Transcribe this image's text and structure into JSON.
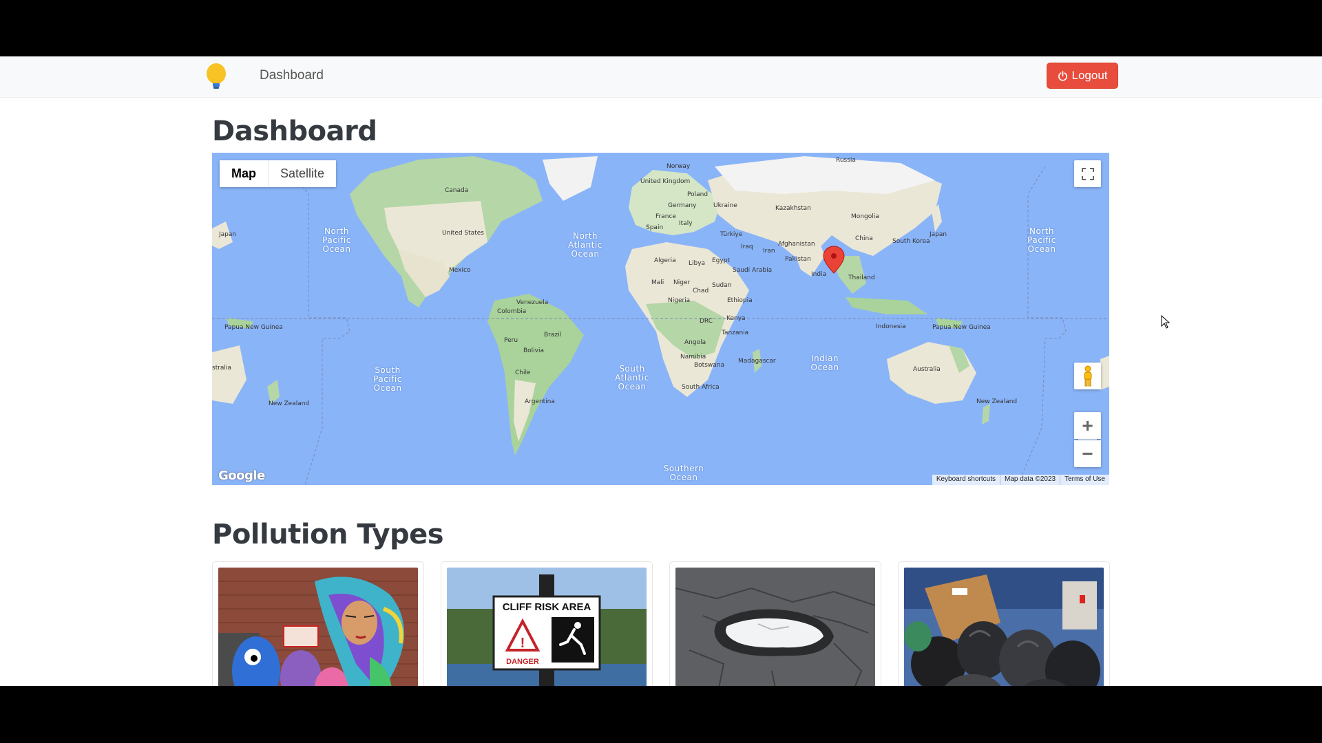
{
  "navbar": {
    "brand_icon": "lightbulb-icon",
    "nav_link": "Dashboard",
    "logout_label": "Logout",
    "logout_icon": "power-icon",
    "logout_color": "#e74c3c"
  },
  "page_title": "Dashboard",
  "map": {
    "map_type_options": [
      "Map",
      "Satellite"
    ],
    "selected_map_type": "Map",
    "oceans": [
      "North Pacific Ocean",
      "North Atlantic Ocean",
      "South Pacific Ocean",
      "South Atlantic Ocean",
      "Indian Ocean",
      "Southern Ocean",
      "North Pacific Ocean"
    ],
    "countries": [
      "Canada",
      "United States",
      "Mexico",
      "Venezuela",
      "Colombia",
      "Peru",
      "Brazil",
      "Bolivia",
      "Chile",
      "Argentina",
      "Norway",
      "United Kingdom",
      "Poland",
      "Germany",
      "Ukraine",
      "France",
      "Italy",
      "Spain",
      "Türkiye",
      "Kazakhstan",
      "Russia",
      "Mongolia",
      "China",
      "Afghanistan",
      "Iran",
      "Iraq",
      "Pakistan",
      "India",
      "Thailand",
      "South Korea",
      "Japan",
      "Algeria",
      "Libya",
      "Egypt",
      "Saudi Arabia",
      "Mali",
      "Niger",
      "Chad",
      "Sudan",
      "Nigeria",
      "Ethiopia",
      "DRC",
      "Kenya",
      "Tanzania",
      "Angola",
      "Namibia",
      "Botswana",
      "Madagascar",
      "South Africa",
      "Indonesia",
      "Papua New Guinea",
      "Australia",
      "New Zealand",
      "Japan",
      "Papua New Guinea",
      "New Zealand",
      "stralia"
    ],
    "marker_icon": "map-pin-icon",
    "marker_color": "#ea4335",
    "google_logo": "Google",
    "attribution": [
      "Keyboard shortcuts",
      "Map data ©2023",
      "Terms of Use"
    ],
    "controls": {
      "fullscreen_icon": "fullscreen-icon",
      "pegman_icon": "street-view-pegman-icon",
      "zoom_in": "+",
      "zoom_out": "−"
    }
  },
  "pollution_title": "Pollution Types",
  "pollution_cards": [
    {
      "image": "graffiti-mural-image"
    },
    {
      "image": "cliff-risk-sign-image",
      "sign_title": "CLIFF RISK AREA",
      "sign_text": "DANGER"
    },
    {
      "image": "pothole-image"
    },
    {
      "image": "garbage-bags-image"
    }
  ]
}
